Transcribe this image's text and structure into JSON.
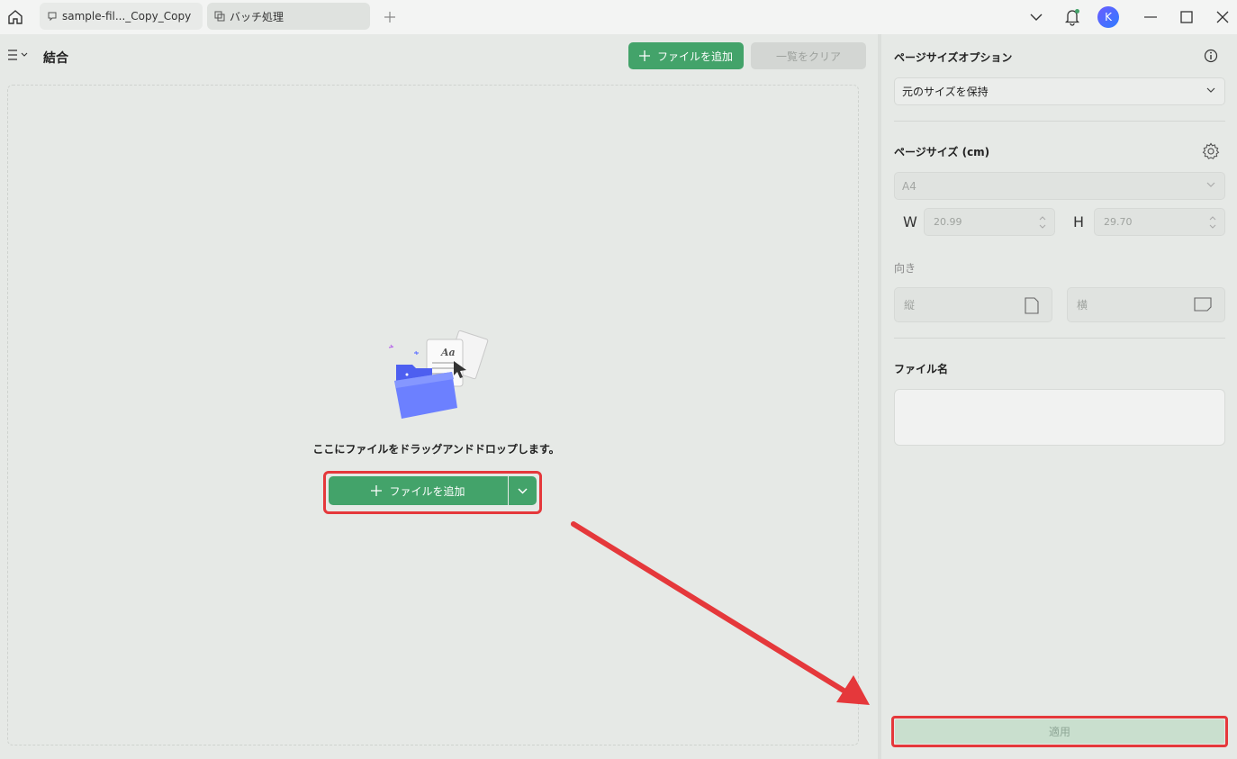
{
  "titlebar": {
    "tabs": [
      {
        "label": "sample-fil..._Copy_Copy"
      },
      {
        "label": "バッチ処理"
      }
    ],
    "avatar_initial": "K"
  },
  "left": {
    "title": "結合",
    "add_file_label": "ファイルを追加",
    "clear_list_label": "一覧をクリア",
    "drop_text": "ここにファイルをドラッグアンドドロップします。",
    "add_file_main_label": "ファイルを追加"
  },
  "right": {
    "page_size_option_label": "ページサイズオプション",
    "page_size_option_value": "元のサイズを保持",
    "page_size_label": "ページサイズ (cm)",
    "paper_value": "A4",
    "width_label": "W",
    "width_value": "20.99",
    "height_label": "H",
    "height_value": "29.70",
    "orientation_label": "向き",
    "portrait_label": "縦",
    "landscape_label": "横",
    "filename_label": "ファイル名",
    "filename_value": "",
    "apply_label": "適用"
  },
  "colors": {
    "accent_green": "#43a36a",
    "highlight_red": "#e5383b",
    "apply_disabled": "#c9dfce"
  }
}
